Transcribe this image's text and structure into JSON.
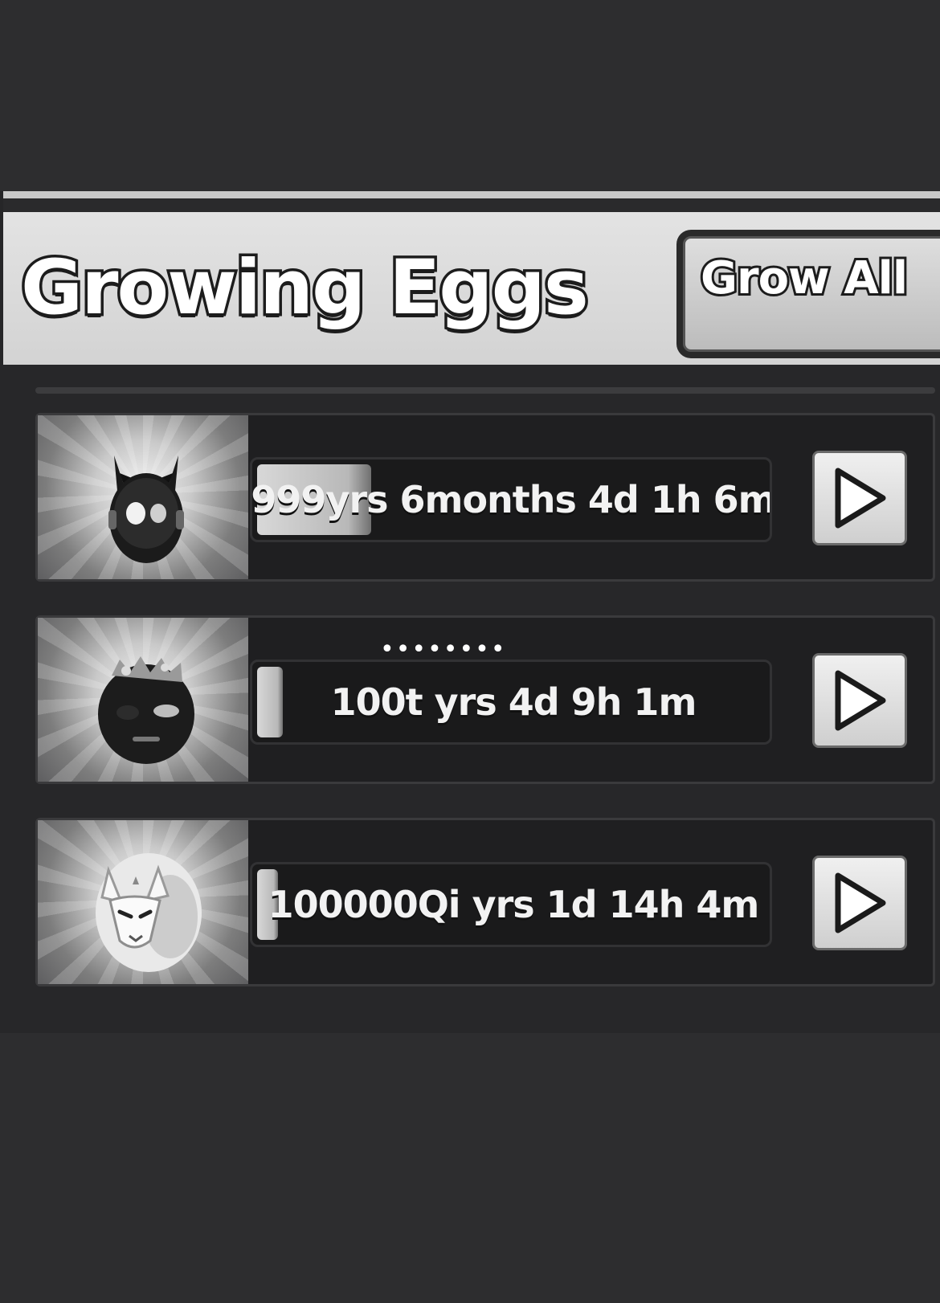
{
  "header": {
    "title": "Growing Eggs",
    "grow_all_label": "Grow All"
  },
  "eggs": [
    {
      "timer": "999yrs 6months 4d 1h 6m",
      "progress": 0.22,
      "icon": "horned-dark-egg-icon"
    },
    {
      "timer": "100t yrs 4d 9h 1m",
      "progress": 0.05,
      "dots": "••••••••",
      "icon": "crowned-dark-egg-icon"
    },
    {
      "timer": "100000Qi yrs 1d 14h 4m",
      "progress": 0.04,
      "icon": "fox-mask-egg-icon"
    }
  ],
  "colors": {
    "background": "#2d2d2f",
    "header_bar": "#dcdcdc",
    "row": "#1f1f21"
  }
}
